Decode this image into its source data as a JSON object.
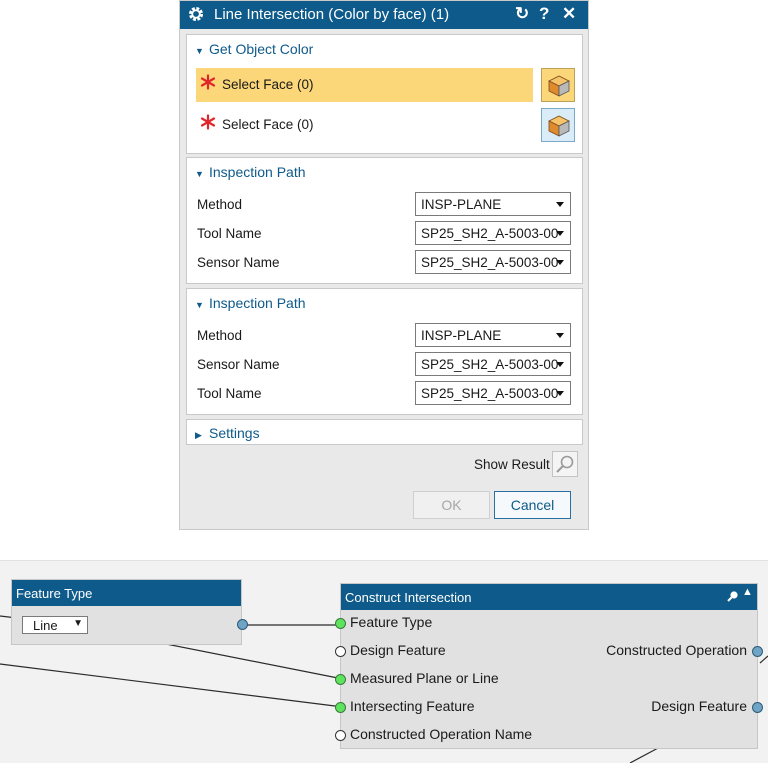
{
  "dialog": {
    "title": "Line Intersection (Color by face) (1)",
    "title_buttons": {
      "reset": "↻",
      "help": "?",
      "close": "✕"
    },
    "get_object_color": {
      "heading": "Get Object Color",
      "rows": [
        {
          "label": "Select Face (0)",
          "active": true
        },
        {
          "label": "Select Face (0)",
          "active": false
        }
      ]
    },
    "inspection_path_1": {
      "heading": "Inspection Path",
      "fields": [
        {
          "label": "Method",
          "value": "INSP-PLANE"
        },
        {
          "label": "Tool Name",
          "value": "SP25_SH2_A-5003-00"
        },
        {
          "label": "Sensor Name",
          "value": "SP25_SH2_A-5003-00"
        }
      ]
    },
    "inspection_path_2": {
      "heading": "Inspection Path",
      "fields": [
        {
          "label": "Method",
          "value": "INSP-PLANE"
        },
        {
          "label": "Sensor Name",
          "value": "SP25_SH2_A-5003-00"
        },
        {
          "label": "Tool Name",
          "value": "SP25_SH2_A-5003-00"
        }
      ]
    },
    "settings": {
      "heading": "Settings"
    },
    "show_result_label": "Show Result",
    "ok_label": "OK",
    "cancel_label": "Cancel"
  },
  "graph": {
    "feature_type_node": {
      "title": "Feature Type",
      "selected": "Line"
    },
    "construct_node": {
      "title": "Construct Intersection",
      "inputs": [
        {
          "label": "Feature Type",
          "connected": true
        },
        {
          "label": "Design Feature",
          "connected": false
        },
        {
          "label": "Measured Plane or Line",
          "connected": true
        },
        {
          "label": "Intersecting Feature",
          "connected": true
        },
        {
          "label": "Constructed Operation Name",
          "connected": false
        }
      ],
      "outputs": [
        {
          "label": "Constructed Operation"
        },
        {
          "label": "Design Feature"
        }
      ]
    }
  },
  "colors": {
    "title_bar": "#0e5a8a",
    "active_row": "#fbd779",
    "required_star": "#e0262b",
    "port_connected": "#5ee35e",
    "port_output": "#6fa4c4"
  }
}
